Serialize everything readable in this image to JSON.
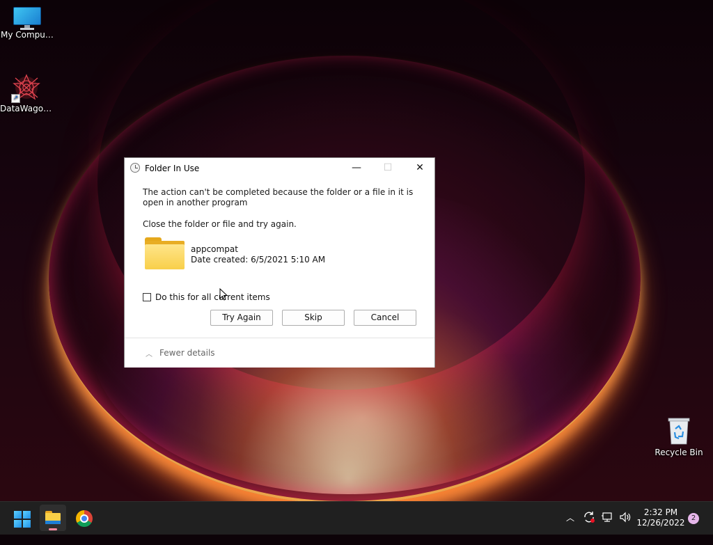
{
  "desktop": {
    "icons": [
      {
        "label": "My Computer"
      },
      {
        "label": "DataWagon..."
      },
      {
        "label": "Recycle Bin"
      }
    ]
  },
  "dialog": {
    "title": "Folder In Use",
    "message": "The action can't be completed because the folder or a file in it is open in another program",
    "instruction": "Close the folder or file and try again.",
    "item_name": "appcompat",
    "item_date": "Date created: 6/5/2021 5:10 AM",
    "checkbox_label": "Do this for all current items",
    "checkbox_checked": false,
    "buttons": {
      "try_again": "Try Again",
      "skip": "Skip",
      "cancel": "Cancel"
    },
    "details_toggle": "Fewer details",
    "controls": {
      "minimize": "—",
      "maximize": "☐",
      "close": "✕"
    }
  },
  "taskbar": {
    "apps": [
      "start-icon",
      "file-explorer-icon",
      "chrome-icon"
    ],
    "tray_icons": [
      "chevron-up-icon",
      "sync-icon",
      "network-icon",
      "volume-icon"
    ],
    "time": "2:32 PM",
    "date": "12/26/2022",
    "notification_count": "2"
  },
  "colors": {
    "taskbar": "#202020",
    "accent": "#1f8fe6",
    "notification_badge": "#e6b6ea"
  }
}
